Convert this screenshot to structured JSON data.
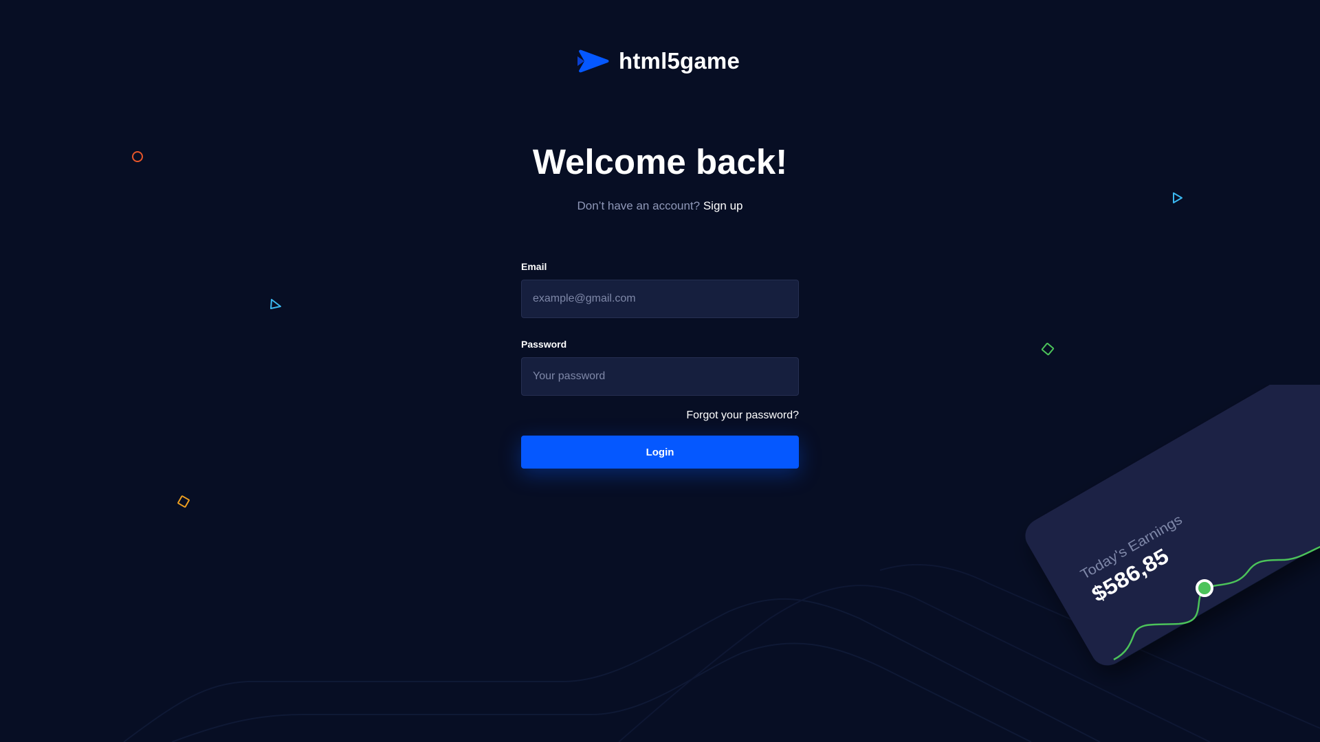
{
  "brand": {
    "name": "html5game",
    "color": "#0558ff"
  },
  "header": {
    "title": "Welcome back!",
    "signup_prompt": "Don’t have an account?",
    "signup_link": "Sign up"
  },
  "form": {
    "email": {
      "label": "Email",
      "placeholder": "example@gmail.com",
      "value": ""
    },
    "password": {
      "label": "Password",
      "placeholder": "Your password",
      "value": ""
    },
    "forgot_link": "Forgot your password?",
    "login_label": "Login"
  },
  "earnings_card": {
    "label": "Today's Earnings",
    "amount": "$586,85"
  },
  "colors": {
    "background": "#070e24",
    "input_bg": "#161f3e",
    "accent": "#0558ff",
    "chart_line": "#4cc35a"
  },
  "decorations": [
    {
      "icon": "circle-outline-icon",
      "color": "#e8562a"
    },
    {
      "icon": "triangle-outline-icon",
      "color": "#3bb8f0"
    },
    {
      "icon": "diamond-outline-icon",
      "color": "#f0a020"
    },
    {
      "icon": "play-outline-icon",
      "color": "#3bb8f0"
    },
    {
      "icon": "square-outline-icon",
      "color": "#4cc35a"
    }
  ]
}
